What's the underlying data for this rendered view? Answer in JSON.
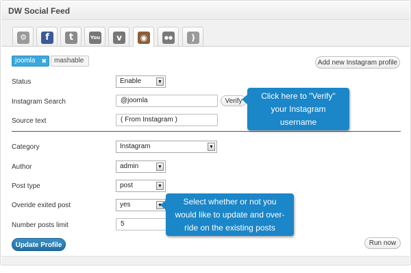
{
  "window": {
    "title": "DW Social Feed"
  },
  "tabs": [
    {
      "name": "settings-tab",
      "icon": "gear-icon",
      "glyph": "⚙",
      "color": "#9a9a9a",
      "active": false
    },
    {
      "name": "facebook-tab",
      "icon": "facebook-icon",
      "glyph": "f",
      "color": "#3b5998",
      "active": false
    },
    {
      "name": "twitter-tab",
      "icon": "twitter-icon",
      "glyph": "t",
      "color": "#8a8a8a",
      "active": false
    },
    {
      "name": "youtube-tab",
      "icon": "youtube-icon",
      "glyph": "You",
      "color": "#777777",
      "active": false
    },
    {
      "name": "vimeo-tab",
      "icon": "vimeo-icon",
      "glyph": "v",
      "color": "#777777",
      "active": false
    },
    {
      "name": "instagram-tab",
      "icon": "instagram-icon",
      "glyph": "◉",
      "color": "#8b5e3c",
      "active": true
    },
    {
      "name": "flickr-tab",
      "icon": "flickr-icon",
      "glyph": "●●",
      "color": "#7a7a7a",
      "active": false
    },
    {
      "name": "rss-tab",
      "icon": "rss-icon",
      "glyph": ")",
      "color": "#9a9a9a",
      "active": false
    }
  ],
  "profiles": {
    "items": [
      {
        "label": "joomla",
        "active": true,
        "remove_glyph": "✖"
      },
      {
        "label": "mashable",
        "active": false
      }
    ],
    "add_label": "Add new Instagram profile"
  },
  "form": {
    "status": {
      "label": "Status",
      "value": "Enable"
    },
    "search": {
      "label": "Instagram Search",
      "value": "@joomla",
      "verify_label": "Verify"
    },
    "source": {
      "label": "Source text",
      "value": "( From Instagram )"
    },
    "category": {
      "label": "Category",
      "value": "Instagram"
    },
    "author": {
      "label": "Author",
      "value": "admin"
    },
    "post_type": {
      "label": "Post type",
      "value": "post"
    },
    "override": {
      "label": "Overide exited post",
      "value": "yes"
    },
    "limit": {
      "label": "Number posts limit",
      "value": "5"
    }
  },
  "buttons": {
    "update": "Update Profile",
    "run": "Run now"
  },
  "callouts": {
    "verify": [
      "Click here to \"Verify\"",
      "your Instagram",
      "username"
    ],
    "override": [
      "Select whether or not you",
      "would like to update and over-",
      "ride on the existing posts"
    ]
  },
  "colors": {
    "accent": "#1b86c8",
    "tag_active": "#3aa8dd",
    "primary_button": "#1e6ea4"
  }
}
